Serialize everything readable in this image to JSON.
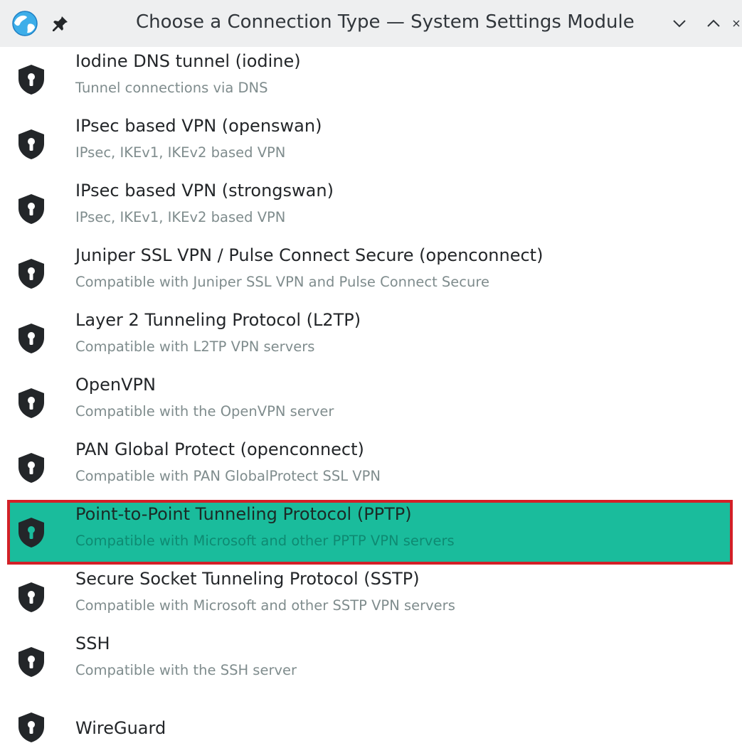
{
  "window": {
    "title": "Choose a Connection Type — System Settings Module",
    "buttons": [
      "chevron-down-icon",
      "chevron-up-icon",
      "close-icon"
    ]
  },
  "connections": [
    {
      "name": "Iodine DNS tunnel (iodine)",
      "description": "Tunnel connections via DNS",
      "selected": false
    },
    {
      "name": "IPsec based VPN (openswan)",
      "description": "IPsec, IKEv1, IKEv2 based VPN",
      "selected": false
    },
    {
      "name": "IPsec based VPN (strongswan)",
      "description": "IPsec, IKEv1, IKEv2 based VPN",
      "selected": false
    },
    {
      "name": "Juniper SSL VPN / Pulse Connect Secure (openconnect)",
      "description": "Compatible with Juniper SSL VPN and Pulse Connect Secure",
      "selected": false
    },
    {
      "name": "Layer 2 Tunneling Protocol (L2TP)",
      "description": "Compatible with L2TP VPN servers",
      "selected": false
    },
    {
      "name": "OpenVPN",
      "description": "Compatible with the OpenVPN server",
      "selected": false
    },
    {
      "name": "PAN Global Protect (openconnect)",
      "description": "Compatible with PAN GlobalProtect SSL VPN",
      "selected": false
    },
    {
      "name": "Point-to-Point Tunneling Protocol (PPTP)",
      "description": "Compatible with Microsoft and other PPTP VPN servers",
      "selected": true
    },
    {
      "name": "Secure Socket Tunneling Protocol (SSTP)",
      "description": "Compatible with Microsoft and other SSTP VPN servers",
      "selected": false
    },
    {
      "name": "SSH",
      "description": "Compatible with the SSH server",
      "selected": false
    },
    {
      "name": "WireGuard",
      "description": "",
      "selected": false
    }
  ],
  "colors": {
    "selection_bg": "#1abc9c",
    "selection_border": "#d32027",
    "icon": "#232629"
  }
}
